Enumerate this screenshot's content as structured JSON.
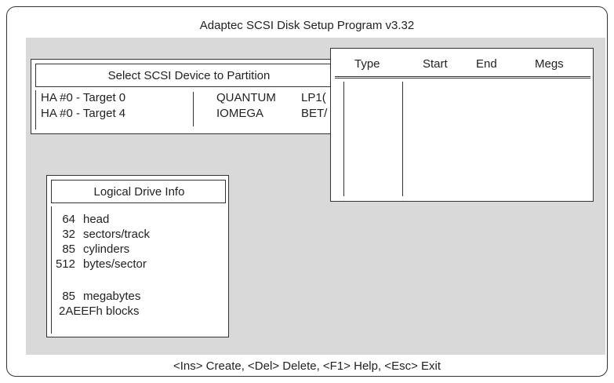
{
  "window": {
    "title": "Adaptec SCSI Disk Setup Program v3.32"
  },
  "select_device": {
    "title": "Select SCSI Device to Partition",
    "rows": [
      {
        "target": "HA #0 - Target 0",
        "vendor": "QUANTUM",
        "model": "LP1("
      },
      {
        "target": "HA #0 - Target 4",
        "vendor": "IOMEGA",
        "model": "BET/"
      }
    ]
  },
  "partition_table": {
    "columns": [
      "Type",
      "Start",
      "End",
      "Megs"
    ]
  },
  "logical_drive": {
    "title": "Logical Drive Info",
    "items": [
      {
        "value": "64",
        "label": "head"
      },
      {
        "value": "32",
        "label": "sectors/track"
      },
      {
        "value": "85",
        "label": "cylinders"
      },
      {
        "value": "512",
        "label": "bytes/sector"
      }
    ],
    "megabytes": {
      "value": "85",
      "label": "megabytes"
    },
    "blocks": "2AEEFh blocks"
  },
  "footer": {
    "hotkeys": "<Ins> Create,  <Del>  Delete,  <F1> Help,  <Esc> Exit"
  }
}
